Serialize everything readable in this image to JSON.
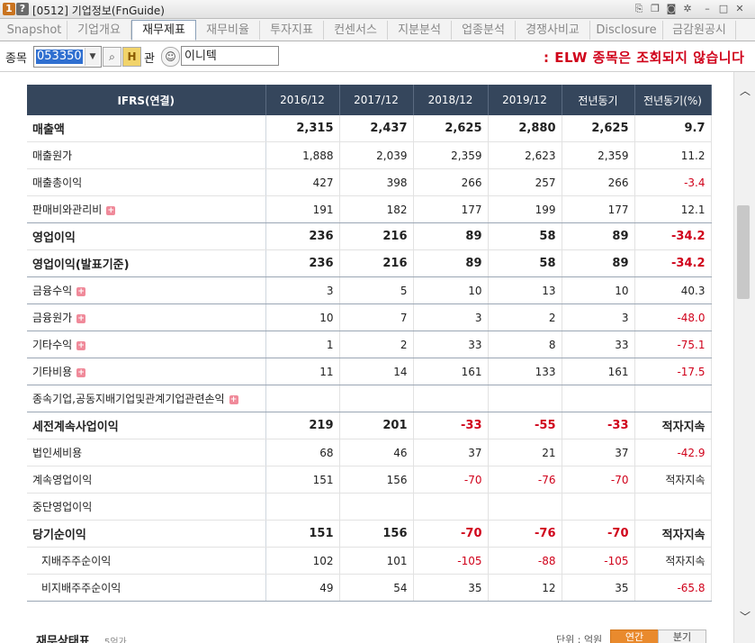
{
  "window": {
    "badge_num": "1",
    "badge_help": "?",
    "title": "[0512] 기업정보(FnGuide)"
  },
  "tabs": [
    {
      "label": "Snapshot",
      "active": false
    },
    {
      "label": "기업개요",
      "active": false
    },
    {
      "label": "재무제표",
      "active": true
    },
    {
      "label": "재무비율",
      "active": false
    },
    {
      "label": "투자지표",
      "active": false
    },
    {
      "label": "컨센서스",
      "active": false
    },
    {
      "label": "지분분석",
      "active": false
    },
    {
      "label": "업종분석",
      "active": false
    },
    {
      "label": "경쟁사비교",
      "active": false
    },
    {
      "label": "Disclosure",
      "active": false
    },
    {
      "label": "금감원공시",
      "active": false
    }
  ],
  "toolbar": {
    "stock_label": "종목",
    "stock_code": "053350",
    "kwan_label": "관",
    "stock_name": "이니텍",
    "notice": "ELW 종목은 조회되지 않습니다"
  },
  "table": {
    "headers": [
      "IFRS(연결)",
      "2016/12",
      "2017/12",
      "2018/12",
      "2019/12",
      "전년동기",
      "전년동기(%)"
    ],
    "rows": [
      {
        "label": "매출액",
        "bold": true,
        "expand": false,
        "indent": false,
        "sep": false,
        "values": [
          "2,315",
          "2,437",
          "2,625",
          "2,880",
          "2,625",
          "9.7"
        ],
        "neg": [
          false,
          false,
          false,
          false,
          false,
          false
        ]
      },
      {
        "label": "매출원가",
        "bold": false,
        "expand": false,
        "indent": false,
        "sep": false,
        "values": [
          "1,888",
          "2,039",
          "2,359",
          "2,623",
          "2,359",
          "11.2"
        ],
        "neg": [
          false,
          false,
          false,
          false,
          false,
          false
        ]
      },
      {
        "label": "매출총이익",
        "bold": false,
        "expand": false,
        "indent": false,
        "sep": false,
        "values": [
          "427",
          "398",
          "266",
          "257",
          "266",
          "-3.4"
        ],
        "neg": [
          false,
          false,
          false,
          false,
          false,
          true
        ]
      },
      {
        "label": "판매비와관리비",
        "bold": false,
        "expand": true,
        "indent": false,
        "sep": true,
        "values": [
          "191",
          "182",
          "177",
          "199",
          "177",
          "12.1"
        ],
        "neg": [
          false,
          false,
          false,
          false,
          false,
          false
        ]
      },
      {
        "label": "영업이익",
        "bold": true,
        "expand": false,
        "indent": false,
        "sep": false,
        "values": [
          "236",
          "216",
          "89",
          "58",
          "89",
          "-34.2"
        ],
        "neg": [
          false,
          false,
          false,
          false,
          false,
          true
        ]
      },
      {
        "label": "영업이익(발표기준)",
        "bold": true,
        "expand": false,
        "indent": false,
        "sep": true,
        "values": [
          "236",
          "216",
          "89",
          "58",
          "89",
          "-34.2"
        ],
        "neg": [
          false,
          false,
          false,
          false,
          false,
          true
        ]
      },
      {
        "label": "금융수익",
        "bold": false,
        "expand": true,
        "indent": false,
        "sep": true,
        "values": [
          "3",
          "5",
          "10",
          "13",
          "10",
          "40.3"
        ],
        "neg": [
          false,
          false,
          false,
          false,
          false,
          false
        ]
      },
      {
        "label": "금융원가",
        "bold": false,
        "expand": true,
        "indent": false,
        "sep": true,
        "values": [
          "10",
          "7",
          "3",
          "2",
          "3",
          "-48.0"
        ],
        "neg": [
          false,
          false,
          false,
          false,
          false,
          true
        ]
      },
      {
        "label": "기타수익",
        "bold": false,
        "expand": true,
        "indent": false,
        "sep": true,
        "values": [
          "1",
          "2",
          "33",
          "8",
          "33",
          "-75.1"
        ],
        "neg": [
          false,
          false,
          false,
          false,
          false,
          true
        ]
      },
      {
        "label": "기타비용",
        "bold": false,
        "expand": true,
        "indent": false,
        "sep": true,
        "values": [
          "11",
          "14",
          "161",
          "133",
          "161",
          "-17.5"
        ],
        "neg": [
          false,
          false,
          false,
          false,
          false,
          true
        ]
      },
      {
        "label": "종속기업,공동지배기업및관계기업관련손익",
        "bold": false,
        "expand": true,
        "indent": false,
        "sep": true,
        "values": [
          "",
          "",
          "",
          "",
          "",
          ""
        ],
        "neg": [
          false,
          false,
          false,
          false,
          false,
          false
        ]
      },
      {
        "label": "세전계속사업이익",
        "bold": true,
        "expand": false,
        "indent": false,
        "sep": false,
        "values": [
          "219",
          "201",
          "-33",
          "-55",
          "-33",
          "적자지속"
        ],
        "neg": [
          false,
          false,
          true,
          true,
          true,
          false
        ]
      },
      {
        "label": "법인세비용",
        "bold": false,
        "expand": false,
        "indent": false,
        "sep": false,
        "values": [
          "68",
          "46",
          "37",
          "21",
          "37",
          "-42.9"
        ],
        "neg": [
          false,
          false,
          false,
          false,
          false,
          true
        ]
      },
      {
        "label": "계속영업이익",
        "bold": false,
        "expand": false,
        "indent": false,
        "sep": false,
        "values": [
          "151",
          "156",
          "-70",
          "-76",
          "-70",
          "적자지속"
        ],
        "neg": [
          false,
          false,
          true,
          true,
          true,
          false
        ]
      },
      {
        "label": "중단영업이익",
        "bold": false,
        "expand": false,
        "indent": false,
        "sep": false,
        "values": [
          "",
          "",
          "",
          "",
          "",
          ""
        ],
        "neg": [
          false,
          false,
          false,
          false,
          false,
          false
        ]
      },
      {
        "label": "당기순이익",
        "bold": true,
        "expand": false,
        "indent": false,
        "sep": false,
        "values": [
          "151",
          "156",
          "-70",
          "-76",
          "-70",
          "적자지속"
        ],
        "neg": [
          false,
          false,
          true,
          true,
          true,
          false
        ]
      },
      {
        "label": "지배주주순이익",
        "bold": false,
        "expand": false,
        "indent": true,
        "sep": false,
        "values": [
          "102",
          "101",
          "-105",
          "-88",
          "-105",
          "적자지속"
        ],
        "neg": [
          false,
          false,
          true,
          true,
          true,
          false
        ]
      },
      {
        "label": "비지배주주순이익",
        "bold": false,
        "expand": false,
        "indent": true,
        "sep": true,
        "values": [
          "49",
          "54",
          "35",
          "12",
          "35",
          "-65.8"
        ],
        "neg": [
          false,
          false,
          false,
          false,
          false,
          true
        ]
      }
    ]
  },
  "footer": {
    "title": "재무상태표",
    "subtitle": "5억가",
    "unit": "단위 : 억원",
    "seg_year": "연간",
    "seg_quarter": "분기"
  },
  "colors": {
    "header_bg": "#35465c",
    "negative": "#d0021b",
    "accent_orange": "#e98a2d"
  }
}
